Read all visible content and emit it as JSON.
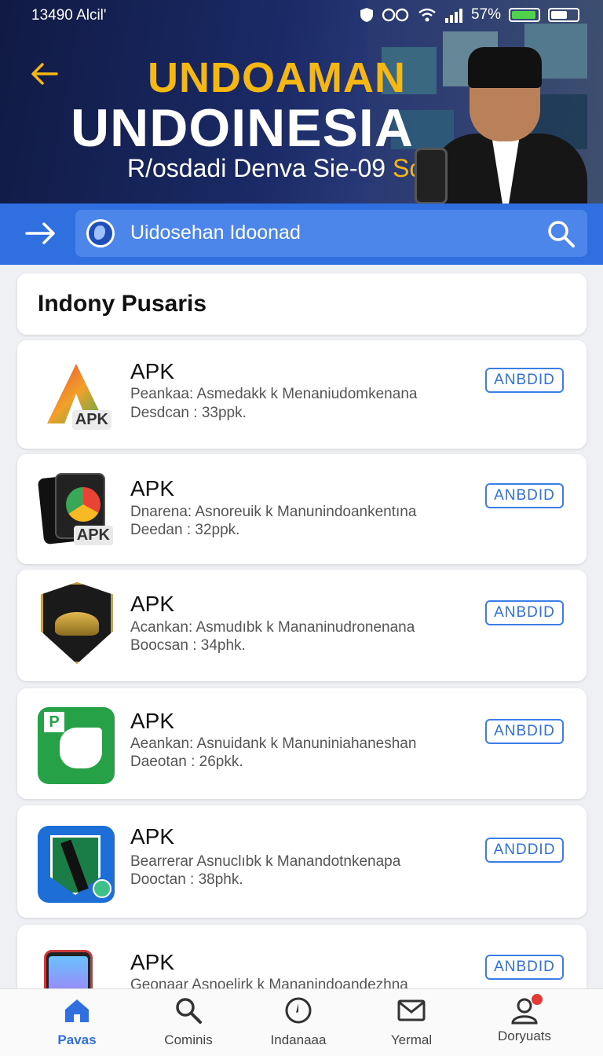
{
  "status_bar": {
    "time": "13490 Alcil'",
    "battery": "57%"
  },
  "hero": {
    "title_line1": "UNDOAMAN",
    "title_line2": "UNDOINESIA",
    "subtitle_main": "R/osdadi Denva Sie-09",
    "subtitle_accent": "Scorm"
  },
  "search": {
    "placeholder": "Uidosehan Idoonad"
  },
  "section": {
    "title": "Indony Pusaris"
  },
  "apps": [
    {
      "name": "APK",
      "desc1": "Peankaa: Asmedakk k Menaniudomkenana",
      "desc2": "Desdcan : 33ppk.",
      "button": "ANBDID",
      "icon": "apk-triangle-icon"
    },
    {
      "name": "APK",
      "desc1": "Dnarena: Asnoreuik k Manunindoankentına",
      "desc2": "Deedan : 32ppk.",
      "button": "ANBDID",
      "icon": "apk-cards-icon"
    },
    {
      "name": "APK",
      "desc1": "Acankan: Asmudıbk k Mananinudronenana",
      "desc2": "Boocsan : 34phk.",
      "button": "ANBDID",
      "icon": "emblem-shield-icon"
    },
    {
      "name": "APK",
      "desc1": "Aeankan: Asnuidank k Manuniniahaneshan",
      "desc2": "Daeotan : 26pkk.",
      "button": "ANBDID",
      "icon": "green-p-icon"
    },
    {
      "name": "APK",
      "desc1": "Bearrerar Asnuclıbk k Manandotnkenapa",
      "desc2": "Dooctan : 38phk.",
      "button": "ANDDID",
      "icon": "blue-shield-icon"
    },
    {
      "name": "APK",
      "desc1": "Geonaar Asnoelirk k Mananindoandezhna",
      "desc2": "",
      "button": "ANBDID",
      "icon": "phone-icon"
    }
  ],
  "nav": [
    {
      "label": "Pavas",
      "icon": "home-icon",
      "active": true
    },
    {
      "label": "Cominis",
      "icon": "search-icon",
      "active": false
    },
    {
      "label": "Indanaaa",
      "icon": "compass-icon",
      "active": false
    },
    {
      "label": "Yermal",
      "icon": "mail-icon",
      "active": false
    },
    {
      "label": "Doryuats",
      "icon": "profile-icon",
      "active": false
    }
  ],
  "colors": {
    "primary": "#2f6fe0",
    "accent": "#f5b714",
    "hero_bg": "#1b2a66"
  }
}
